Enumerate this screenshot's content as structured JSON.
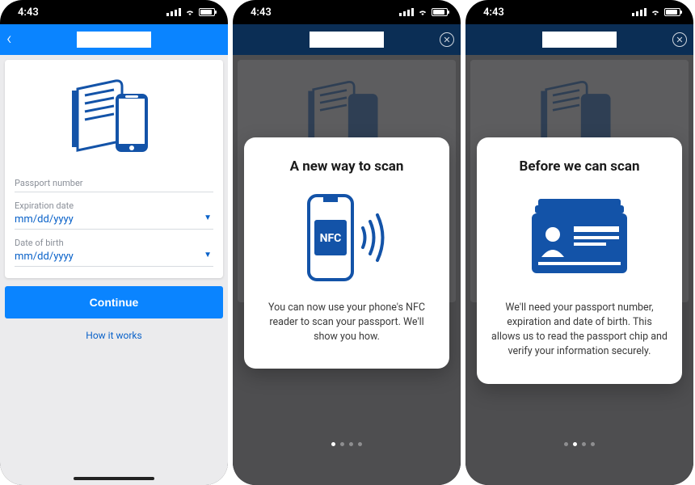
{
  "status": {
    "time": "4:43"
  },
  "screen1": {
    "form": {
      "passport_label": "Passport number",
      "expiration_label": "Expiration date",
      "expiration_value": "mm/dd/yyyy",
      "dob_label": "Date of birth",
      "dob_value": "mm/dd/yyyy"
    },
    "continue_label": "Continue",
    "how_link": "How it works"
  },
  "screen2": {
    "modal": {
      "title": "A new way to scan",
      "nfc_label": "NFC",
      "body": "You can now use your phone's NFC reader to scan your passport. We'll show you how."
    },
    "page_index": 0,
    "page_count": 4
  },
  "screen3": {
    "modal": {
      "title": "Before we can scan",
      "body": "We'll need your passport number, expiration and date of birth. This allows us to read the passport chip and verify your information securely."
    },
    "page_index": 1,
    "page_count": 4
  }
}
